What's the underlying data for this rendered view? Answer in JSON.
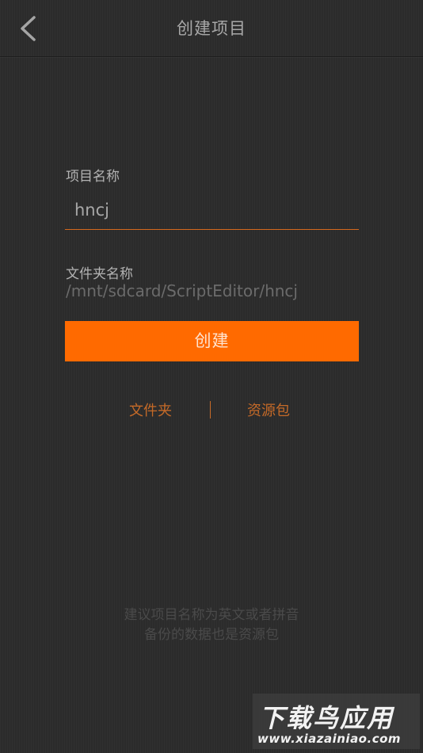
{
  "header": {
    "title": "创建项目",
    "back_icon": "chevron-left-icon"
  },
  "form": {
    "project_name_label": "项目名称",
    "project_name_value": "hncj",
    "folder_name_label": "文件夹名称",
    "folder_path": "/mnt/sdcard/ScriptEditor/hncj",
    "create_button_label": "创建"
  },
  "tabs": {
    "folder_label": "文件夹",
    "package_label": "资源包"
  },
  "hints": {
    "line1": "建议项目名称为英文或者拼音",
    "line2": "备份的数据也是资源包"
  },
  "watermark": {
    "title": "下载鸟应用",
    "url": "www.xiazainiao.com"
  },
  "colors": {
    "accent": "#ff6a00",
    "background": "#2b2b2b",
    "link": "#c56a28"
  }
}
